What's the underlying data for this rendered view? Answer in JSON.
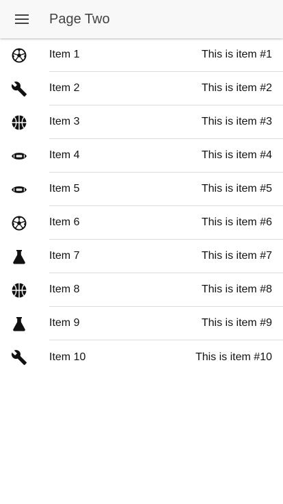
{
  "toolbar": {
    "menu_icon": "menu-icon",
    "title": "Page Two"
  },
  "items": [
    {
      "label": "Item 1",
      "note": "This is item #1",
      "icon": "soccer-ball-icon"
    },
    {
      "label": "Item 2",
      "note": "This is item #2",
      "icon": "wrench-icon"
    },
    {
      "label": "Item 3",
      "note": "This is item #3",
      "icon": "basketball-icon"
    },
    {
      "label": "Item 4",
      "note": "This is item #4",
      "icon": "football-icon"
    },
    {
      "label": "Item 5",
      "note": "This is item #5",
      "icon": "football-icon"
    },
    {
      "label": "Item 6",
      "note": "This is item #6",
      "icon": "soccer-ball-icon"
    },
    {
      "label": "Item 7",
      "note": "This is item #7",
      "icon": "flask-icon"
    },
    {
      "label": "Item 8",
      "note": "This is item #8",
      "icon": "basketball-icon"
    },
    {
      "label": "Item 9",
      "note": "This is item #9",
      "icon": "flask-icon"
    },
    {
      "label": "Item 10",
      "note": "This is item #10",
      "icon": "wrench-icon"
    }
  ]
}
